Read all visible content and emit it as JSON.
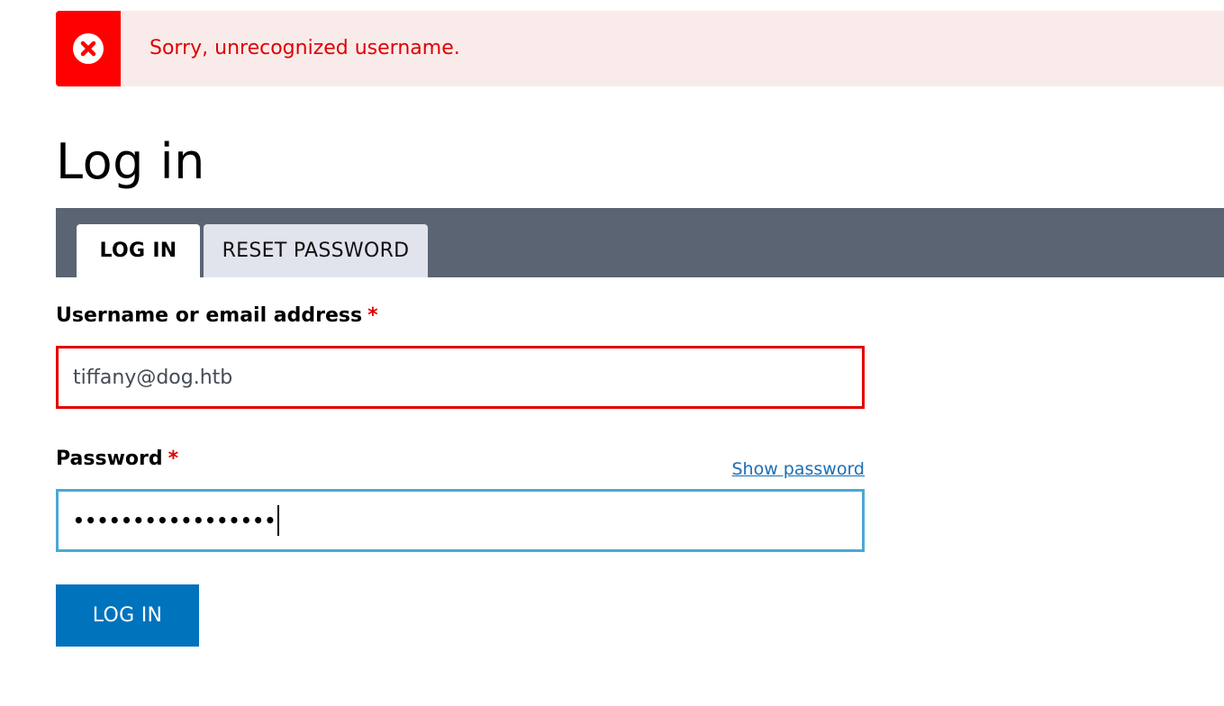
{
  "messages": {
    "error_text": "Sorry, unrecognized username.",
    "error_icon": "error-circle-x-icon",
    "error_color": "#ff0000",
    "error_background": "#f9ebea"
  },
  "page": {
    "title": "Log in"
  },
  "tabs": [
    {
      "label": "LOG IN",
      "active": true
    },
    {
      "label": "RESET PASSWORD",
      "active": false
    }
  ],
  "form": {
    "username": {
      "label": "Username or email address",
      "required_marker": "*",
      "value": "tiffany@dog.htb",
      "state": "error"
    },
    "password": {
      "label": "Password",
      "required_marker": "*",
      "masked_value": "•••••••••••••••••",
      "state": "focused",
      "show_password_label": "Show password"
    },
    "submit_label": "LOG IN"
  },
  "colors": {
    "tabs_bar": "#5a6473",
    "primary_button": "#0073bd",
    "link": "#1a6eb5",
    "error_border": "#e00000",
    "focus_border": "#4ba8d8"
  }
}
